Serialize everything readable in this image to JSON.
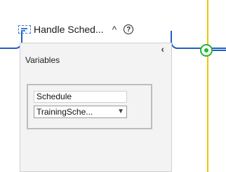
{
  "activity": {
    "title": "Handle Sched...",
    "collapse_glyph": "^",
    "help_glyph": "?",
    "icon": "sequence-activity-icon"
  },
  "panel": {
    "collapse_glyph": "‹",
    "title": "Variables",
    "variable": {
      "name": "Schedule",
      "type": "TrainingSche...",
      "dropdown_glyph": "▼"
    }
  },
  "colors": {
    "wire_blue": "#1f5fbf",
    "wire_yellow": "#f2c400",
    "node_green": "#22b533"
  }
}
